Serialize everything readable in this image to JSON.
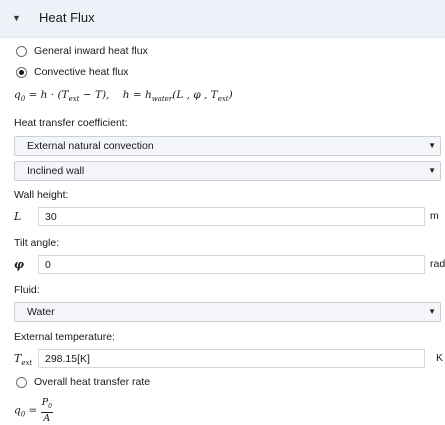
{
  "section": {
    "title": "Heat Flux"
  },
  "options": {
    "general_inward": "General inward heat flux",
    "convective": "Convective heat flux",
    "overall": "Overall heat transfer rate"
  },
  "equations": {
    "q0_lhs": "q",
    "q0_sub": "0",
    "convective_rhs": " = h · (T",
    "convective_ext": "ext",
    "convective_tail": " − T),",
    "h_lhs": "h",
    "h_eq": " = h",
    "h_sub": "water",
    "h_args": "(L , φ , T",
    "h_args_sub": "ext",
    "h_args_close": ")",
    "overall_eq": " = ",
    "overall_num": "P",
    "overall_num_sub": "0",
    "overall_den": "A"
  },
  "htc": {
    "label": "Heat transfer coefficient:",
    "type_value": "External natural convection",
    "geometry_value": "Inclined wall"
  },
  "wall_height": {
    "label": "Wall height:",
    "symbol": "L",
    "value": "30",
    "unit": "m"
  },
  "tilt_angle": {
    "label": "Tilt angle:",
    "symbol": "φ",
    "value": "0",
    "unit": "rad"
  },
  "fluid": {
    "label": "Fluid:",
    "value": "Water"
  },
  "ext_temp": {
    "label": "External temperature:",
    "symbol": "T",
    "symbol_sub": "ext",
    "value": "298.15[K]",
    "unit": "K"
  },
  "icons": {
    "collapse": "triangle-down-icon",
    "combo": "chevron-down-icon"
  }
}
